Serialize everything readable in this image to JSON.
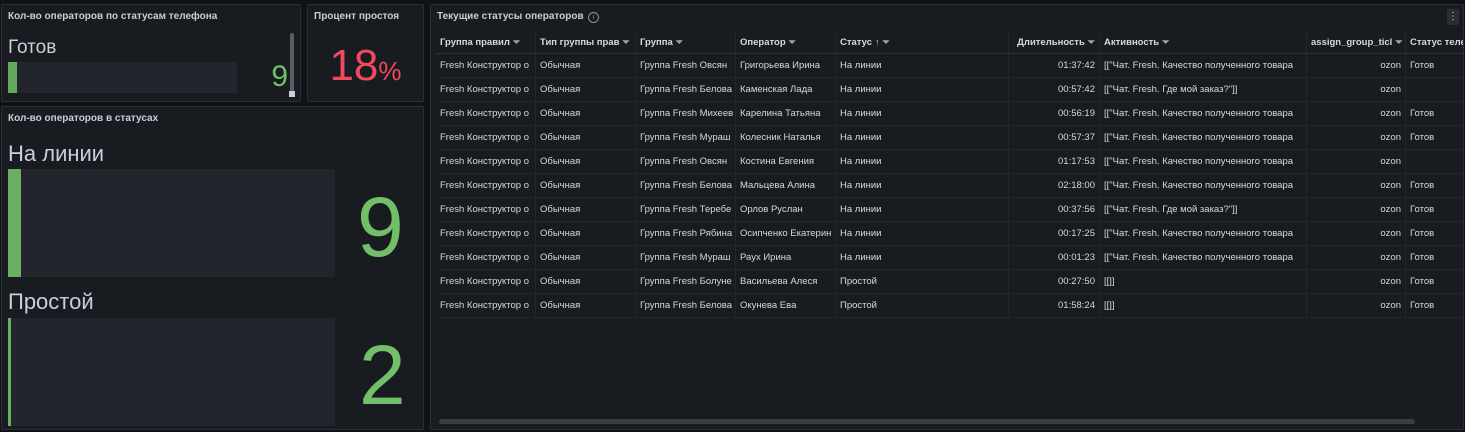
{
  "panels": {
    "phone_status": {
      "title": "Кол-во операторов по статусам телефона",
      "label": "Готов",
      "value": "9",
      "bar_fraction": 0.04
    },
    "idle_percent": {
      "title": "Процент простоя",
      "value": "18",
      "unit": "%"
    },
    "operators_by_status": {
      "title": "Кол-во операторов в статусах",
      "rows": [
        {
          "label": "На линии",
          "value": "9",
          "bar_fraction": 0.04
        },
        {
          "label": "Простой",
          "value": "2",
          "bar_fraction": 0.01
        }
      ]
    },
    "current_statuses": {
      "title": "Текущие статусы операторов",
      "info_icon": "info-icon",
      "menu_icon": "kebab-menu-icon",
      "columns": [
        {
          "label": "Группа правил",
          "filter": true
        },
        {
          "label": "Тип группы прав",
          "filter": true
        },
        {
          "label": "Группа",
          "filter": true
        },
        {
          "label": "Оператор",
          "filter": true
        },
        {
          "label": "Статус",
          "filter": true,
          "sort": "↑"
        },
        {
          "label": "Длительность",
          "filter": true
        },
        {
          "label": "Активность",
          "filter": true
        },
        {
          "label": "assign_group_ticl",
          "filter": true
        },
        {
          "label": "Статус теле",
          "filter": false
        }
      ],
      "rows": [
        [
          "Fresh Конструктор о",
          "Обычная",
          "Группа Fresh Овсян",
          "Григорьева Ирина",
          "На линии",
          "01:37:42",
          "[[\"Чат. Fresh. Качество полученного товара",
          "ozon",
          "Готов"
        ],
        [
          "Fresh Конструктор о",
          "Обычная",
          "Группа Fresh Белова",
          "Каменская Лада",
          "На линии",
          "00:57:42",
          "[[\"Чат. Fresh. Где мой заказ?\"]]",
          "ozon",
          ""
        ],
        [
          "Fresh Конструктор о",
          "Обычная",
          "Группа Fresh Михеев",
          "Карелина Татьяна",
          "На линии",
          "00:56:19",
          "[[\"Чат. Fresh. Качество полученного товара",
          "ozon",
          "Готов"
        ],
        [
          "Fresh Конструктор о",
          "Обычная",
          "Группа Fresh Мураш",
          "Колесник Наталья",
          "На линии",
          "00:57:37",
          "[[\"Чат. Fresh. Качество полученного товара",
          "ozon",
          "Готов"
        ],
        [
          "Fresh Конструктор о",
          "Обычная",
          "Группа Fresh Овсян",
          "Костина Евгения",
          "На линии",
          "01:17:53",
          "[[\"Чат. Fresh. Качество полученного товара",
          "ozon",
          ""
        ],
        [
          "Fresh Конструктор о",
          "Обычная",
          "Группа Fresh Белова",
          "Мальцева Алина",
          "На линии",
          "02:18:00",
          "[[\"Чат. Fresh. Качество полученного товара",
          "ozon",
          "Готов"
        ],
        [
          "Fresh Конструктор о",
          "Обычная",
          "Группа Fresh Теребе",
          "Орлов Руслан",
          "На линии",
          "00:37:56",
          "[[\"Чат. Fresh. Где мой заказ?\"]]",
          "ozon",
          "Готов"
        ],
        [
          "Fresh Конструктор о",
          "Обычная",
          "Группа Fresh Рябина",
          "Осипченко Екатерин",
          "На линии",
          "00:17:25",
          "[[\"Чат. Fresh. Качество полученного товара",
          "ozon",
          "Готов"
        ],
        [
          "Fresh Конструктор о",
          "Обычная",
          "Группа Fresh Мураш",
          "Раух Ирина",
          "На линии",
          "00:01:23",
          "[[\"Чат. Fresh. Качество полученного товара",
          "ozon",
          "Готов"
        ],
        [
          "Fresh Конструктор о",
          "Обычная",
          "Группа Fresh Болуне",
          "Васильева Алеся",
          "Простой",
          "00:27:50",
          "[[]]",
          "ozon",
          "Готов"
        ],
        [
          "Fresh Конструктор о",
          "Обычная",
          "Группа Fresh Белова",
          "Окунева Ева",
          "Простой",
          "01:58:24",
          "[[]]",
          "ozon",
          "Готов"
        ]
      ]
    }
  },
  "colors": {
    "background": "#111217",
    "panel": "#181b1f",
    "green": "#73bf69",
    "red": "#f2495c"
  }
}
